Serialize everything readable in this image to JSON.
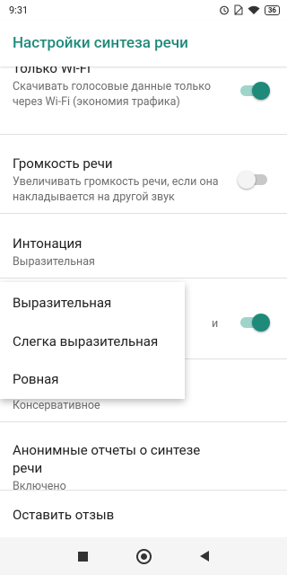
{
  "status_bar": {
    "time": "9:31",
    "battery": "36"
  },
  "app_bar": {
    "title": "Настройки синтеза речи"
  },
  "settings": {
    "wifi_only": {
      "title": "Только Wi-Fi",
      "subtitle": "Скачивать голосовые данные только через Wi-Fi (экономия трафика)",
      "state": "on"
    },
    "volume": {
      "title": "Громкость речи",
      "subtitle": "Увеличивать громкость речи, если она накладывается на другой звук",
      "state": "off"
    },
    "intonation": {
      "title": "Интонация",
      "subtitle": "Выразительная"
    },
    "hidden_row": {
      "subtitle_fragment": "и",
      "state": "on"
    },
    "behind_popup": {
      "subtitle": "Консервативное"
    },
    "anon_reports": {
      "title": "Анонимные отчеты о синтезе речи",
      "subtitle": "Включено"
    },
    "feedback": {
      "title": "Оставить отзыв"
    }
  },
  "intonation_menu": {
    "options": [
      "Выразительная",
      "Слегка выразительная",
      "Ровная"
    ]
  },
  "colors": {
    "accent": "#1e8a7a"
  }
}
